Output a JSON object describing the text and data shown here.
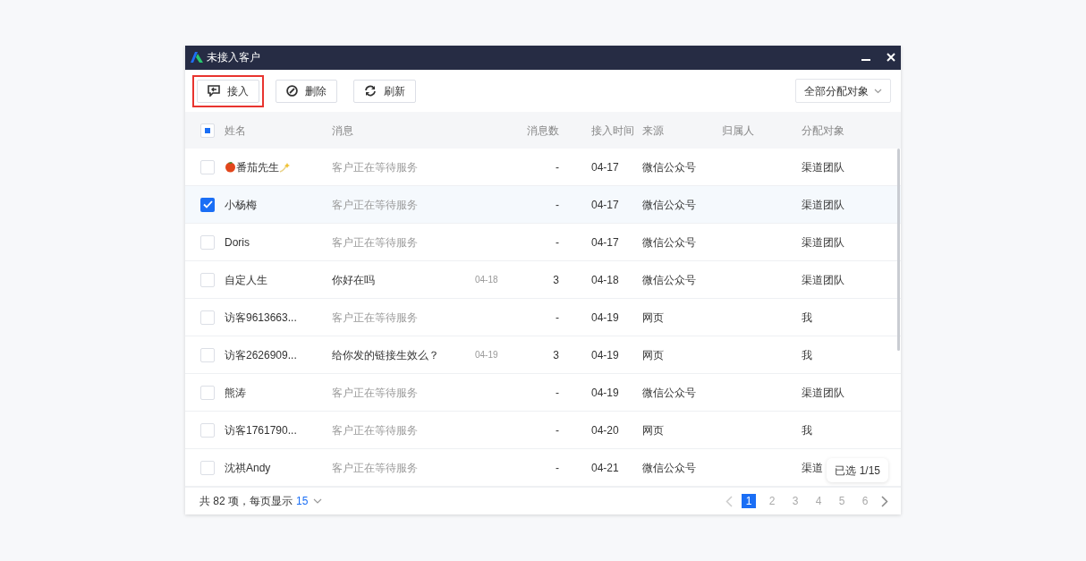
{
  "window": {
    "title": "未接入客户"
  },
  "toolbar": {
    "buttons": [
      {
        "label": "接入",
        "kind": "accept",
        "highlighted": true
      },
      {
        "label": "删除",
        "kind": "delete",
        "highlighted": false
      },
      {
        "label": "刷新",
        "kind": "refresh",
        "highlighted": false
      }
    ],
    "filter": {
      "value": "全部分配对象"
    }
  },
  "table": {
    "select_all": {
      "indeterminate": true
    },
    "columns": [
      "姓名",
      "消息",
      "消息数",
      "接入时间",
      "来源",
      "归属人",
      "分配对象"
    ],
    "rows": [
      {
        "kind": "decorated",
        "selected": false,
        "name": "番茄先生",
        "message": "客户正在等待服务",
        "message_muted": true,
        "count": "-",
        "time": "04-17",
        "source": "微信公众号",
        "assignee": "渠道团队"
      },
      {
        "kind": "plain",
        "selected": true,
        "name": "小杨梅",
        "message": "客户正在等待服务",
        "message_muted": true,
        "count": "-",
        "time": "04-17",
        "source": "微信公众号",
        "assignee": "渠道团队"
      },
      {
        "kind": "plain",
        "selected": false,
        "name": "Doris",
        "message": "客户正在等待服务",
        "message_muted": true,
        "count": "-",
        "time": "04-17",
        "source": "微信公众号",
        "assignee": "渠道团队"
      },
      {
        "kind": "plain",
        "selected": false,
        "name": "自定人生",
        "message": "你好在吗",
        "message_muted": false,
        "message_time": "04-18",
        "count": "3",
        "time": "04-18",
        "source": "微信公众号",
        "assignee": "渠道团队"
      },
      {
        "kind": "plain",
        "selected": false,
        "name": "访客9613663...",
        "message": "客户正在等待服务",
        "message_muted": true,
        "count": "-",
        "time": "04-19",
        "source": "网页",
        "assignee": "我"
      },
      {
        "kind": "plain",
        "selected": false,
        "name": "访客2626909...",
        "message": "给你发的链接生效么？",
        "message_muted": false,
        "message_time": "04-19",
        "count": "3",
        "time": "04-19",
        "source": "网页",
        "assignee": "我"
      },
      {
        "kind": "plain",
        "selected": false,
        "name": "熊涛",
        "message": "客户正在等待服务",
        "message_muted": true,
        "count": "-",
        "time": "04-19",
        "source": "微信公众号",
        "assignee": "渠道团队"
      },
      {
        "kind": "plain",
        "selected": false,
        "name": "访客1761790...",
        "message": "客户正在等待服务",
        "message_muted": true,
        "count": "-",
        "time": "04-20",
        "source": "网页",
        "assignee": "我"
      },
      {
        "kind": "plain",
        "selected": false,
        "name": "沈祺Andy",
        "message": "客户正在等待服务",
        "message_muted": true,
        "count": "-",
        "time": "04-21",
        "source": "微信公众号",
        "assignee": "渠道"
      }
    ]
  },
  "selection_tip": "已选 1/15",
  "footer": {
    "total": "共 82 项，每页显示",
    "page_size": "15",
    "pages": [
      {
        "label": "1",
        "selected": true
      },
      {
        "label": "2",
        "selected": false
      },
      {
        "label": "3",
        "selected": false
      },
      {
        "label": "4",
        "selected": false
      },
      {
        "label": "5",
        "selected": false
      },
      {
        "label": "6",
        "selected": false
      }
    ],
    "prev_disabled": true
  }
}
